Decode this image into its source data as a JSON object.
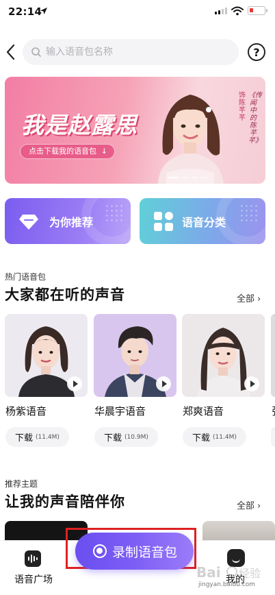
{
  "status_bar": {
    "time": "22:14"
  },
  "search": {
    "placeholder": "输入语音包名称"
  },
  "banner": {
    "title": "我是赵露思",
    "cta_label": "点击下载我的语音包",
    "side_role": "饰陈芊芊",
    "side_show": "《传闻中的陈芊芊》"
  },
  "categories": [
    {
      "label": "为你推荐"
    },
    {
      "label": "语音分类"
    }
  ],
  "hot_section": {
    "subtitle": "热门语音包",
    "title": "大家都在听的声音",
    "more_label": "全部",
    "download_label": "下载",
    "items": [
      {
        "name": "杨紫语音",
        "size": "(11.4M)"
      },
      {
        "name": "华晨宇语音",
        "size": "(10.9M)"
      },
      {
        "name": "郑爽语音",
        "size": "(11.4M)"
      }
    ],
    "partial_item": {
      "name": "张"
    }
  },
  "theme_section": {
    "subtitle": "推荐主题",
    "title": "让我的声音陪伴你",
    "more_label": "全部"
  },
  "bottom_nav": {
    "plaza_label": "语音广场",
    "record_label": "录制语音包",
    "mine_label": "我的"
  },
  "watermark": {
    "text": "jingyan.baidu.com"
  },
  "colors": {
    "accent": "#6a4ff0",
    "banner_pink": "#f27ea5",
    "highlight_red": "#e02020"
  }
}
